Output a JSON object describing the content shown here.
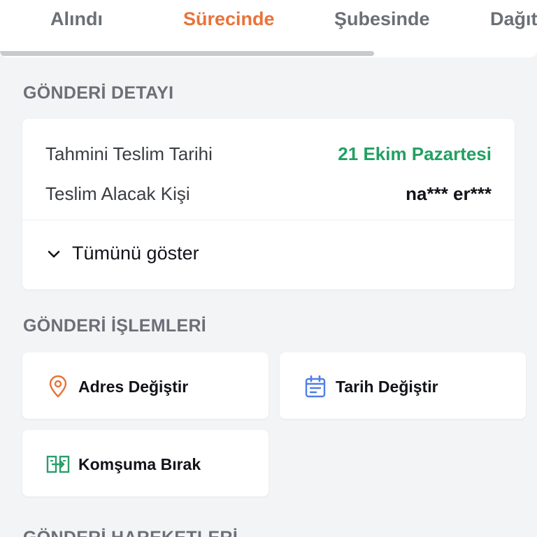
{
  "tabs": [
    {
      "label": "Alındı"
    },
    {
      "label": "Sürecinde",
      "active": true
    },
    {
      "label": "Şubesinde"
    },
    {
      "label": "Dağıt"
    }
  ],
  "progress": {
    "fraction": 0.697
  },
  "detail": {
    "section_title": "GÖNDERİ DETAYI",
    "rows": [
      {
        "label": "Tahmini Teslim Tarihi",
        "value": "21 Ekim Pazartesi"
      },
      {
        "label": "Teslim Alacak Kişi",
        "value": "na*** er***"
      }
    ],
    "show_all": "Tümünü göster"
  },
  "actions": {
    "section_title": "GÖNDERİ İŞLEMLERİ",
    "items": [
      {
        "label": "Adres Değiştir",
        "icon": "location-pin-icon"
      },
      {
        "label": "Tarih Değiştir",
        "icon": "calendar-icon"
      },
      {
        "label": "Komşuma Bırak",
        "icon": "neighbor-transfer-icon"
      }
    ]
  },
  "movements": {
    "section_title": "GÖNDERİ HAREKETLERİ"
  },
  "colors": {
    "accent": "#e8733a",
    "date_green": "#22a063",
    "pin_orange": "#e8733a",
    "calendar_blue": "#4f7fe6",
    "neighbor_green": "#2a9d6a"
  }
}
